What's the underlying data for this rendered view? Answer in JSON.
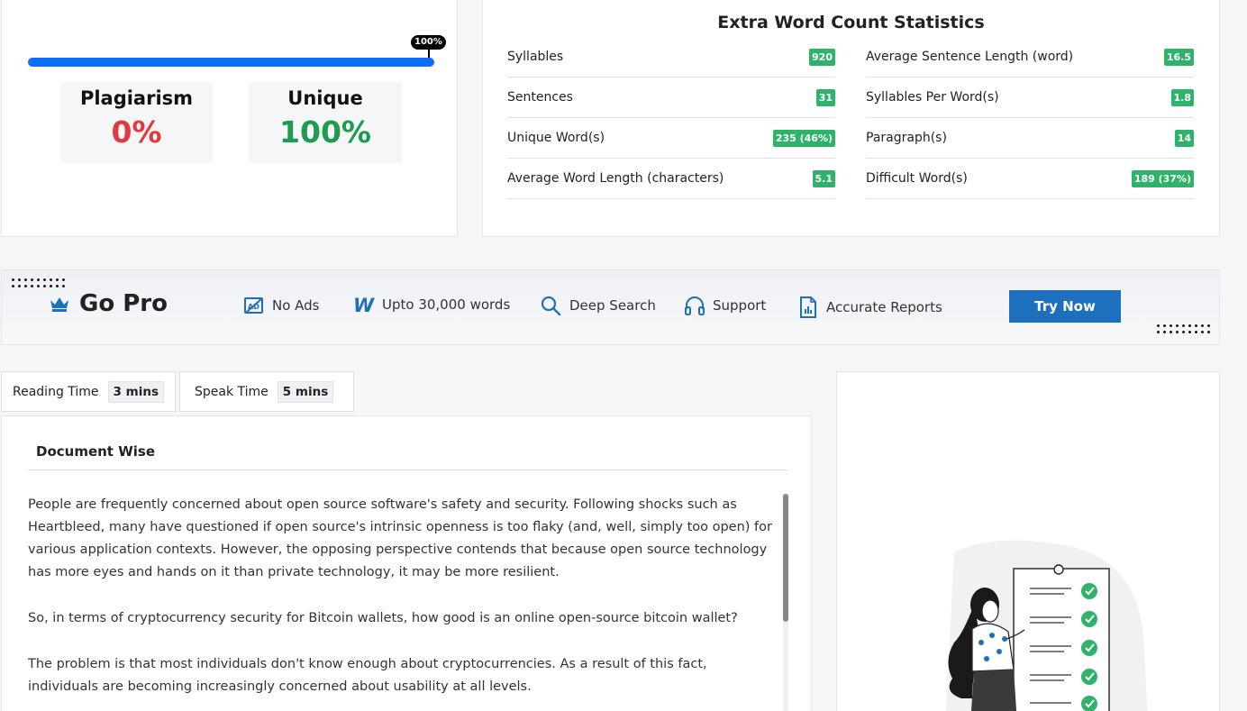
{
  "plagiarism": {
    "progress_label": "100%",
    "progress_fraction": 1.0,
    "plagiarism_label": "Plagiarism",
    "plagiarism_value": "0%",
    "unique_label": "Unique",
    "unique_value": "100%",
    "colors": {
      "plagiarism": "#e0393e",
      "unique": "#1e9b4e",
      "bar": "#0d6efd"
    }
  },
  "extra_stats": {
    "title": "Extra Word Count Statistics",
    "left": [
      {
        "label": "Syllables",
        "value": "920"
      },
      {
        "label": "Sentences",
        "value": "31"
      },
      {
        "label": "Unique Word(s)",
        "value": "235 (46%)"
      },
      {
        "label": "Average Word Length (characters)",
        "value": "5.1"
      }
    ],
    "right": [
      {
        "label": "Average Sentence Length (word)",
        "value": "16.5"
      },
      {
        "label": "Syllables Per Word(s)",
        "value": "1.8"
      },
      {
        "label": "Paragraph(s)",
        "value": "14"
      },
      {
        "label": "Difficult Word(s)",
        "value": "189 (37%)"
      }
    ]
  },
  "gopro": {
    "title": "Go Pro",
    "title_icon": "crown-icon",
    "features": [
      {
        "label": "No Ads",
        "icon": "no-ads-icon"
      },
      {
        "label": "Upto 30,000 words",
        "icon": "w-letter-icon"
      },
      {
        "label": "Deep Search",
        "icon": "search-icon"
      },
      {
        "label": "Support",
        "icon": "headphones-icon"
      },
      {
        "label": "Accurate Reports",
        "icon": "report-icon"
      }
    ],
    "button_label": "Try Now",
    "accent_color": "#1f6fbf"
  },
  "tabs": {
    "reading_label": "Reading Time",
    "reading_value": "3 mins",
    "speak_label": "Speak Time",
    "speak_value": "5 mins"
  },
  "document": {
    "heading": "Document Wise",
    "paragraphs": [
      "People are frequently concerned about open source software's safety and security. Following shocks such as Heartbleed, many have questioned if open source's intrinsic openness is too flaky (and, well, simply too open) for various application contexts. However, the opposing perspective contends that because open source technology has more eyes and hands on it than private technology, it may be more resilient.",
      "So, in terms of cryptocurrency security for Bitcoin wallets, how good is an online open-source bitcoin wallet?",
      "The problem is that most individuals don't know enough about cryptocurrencies. As a result of this fact, individuals are becoming increasingly concerned about usability at all levels."
    ]
  },
  "illustration": {
    "icon": "checklist-woman-illustration"
  }
}
